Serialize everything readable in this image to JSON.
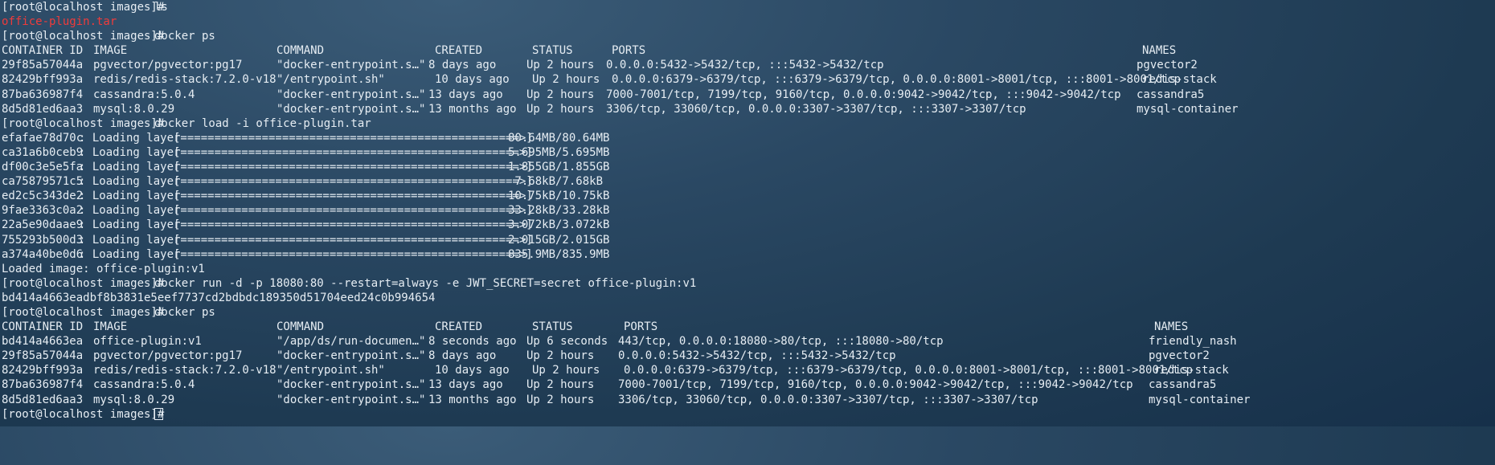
{
  "prompt": "[root@localhost images]# ",
  "ls_cmd": "ls",
  "ls_result": "office-plugin.tar",
  "ps_cmd": "docker ps",
  "headers": {
    "id": "CONTAINER ID",
    "image": "IMAGE",
    "command": "COMMAND",
    "created": "CREATED",
    "status": "STATUS",
    "ports": "PORTS",
    "names": "NAMES"
  },
  "ps1_rows": [
    {
      "id": "29f85a57044a",
      "image": "pgvector/pgvector:pg17",
      "command": "\"docker-entrypoint.s…\"",
      "created": "8 days ago",
      "status": "Up 2 hours",
      "ports": "0.0.0.0:5432->5432/tcp, :::5432->5432/tcp",
      "names": "pgvector2"
    },
    {
      "id": "82429bff993a",
      "image": "redis/redis-stack:7.2.0-v18",
      "command": "\"/entrypoint.sh\"",
      "created": "10 days ago",
      "status": "Up 2 hours",
      "ports": "0.0.0.0:6379->6379/tcp, :::6379->6379/tcp, 0.0.0.0:8001->8001/tcp, :::8001->8001/tcp",
      "names": "redis-stack"
    },
    {
      "id": "87ba636987f4",
      "image": "cassandra:5.0.4",
      "command": "\"docker-entrypoint.s…\"",
      "created": "13 days ago",
      "status": "Up 2 hours",
      "ports": "7000-7001/tcp, 7199/tcp, 9160/tcp, 0.0.0.0:9042->9042/tcp, :::9042->9042/tcp",
      "names": "cassandra5"
    },
    {
      "id": "8d5d81ed6aa3",
      "image": "mysql:8.0.29",
      "command": "\"docker-entrypoint.s…\"",
      "created": "13 months ago",
      "status": "Up 2 hours",
      "ports": "3306/tcp, 33060/tcp, 0.0.0.0:3307->3307/tcp, :::3307->3307/tcp",
      "names": "mysql-container"
    }
  ],
  "load_cmd": "docker load -i office-plugin.tar",
  "layers": [
    {
      "id": "efafae78d70c",
      "bar": "[==================================================>]",
      "size": "80.64MB/80.64MB"
    },
    {
      "id": "ca31a6b0ceb9",
      "bar": "[==================================================>]",
      "size": "5.695MB/5.695MB"
    },
    {
      "id": "df00c3e5e5fa",
      "bar": "[==================================================>]",
      "size": "1.855GB/1.855GB"
    },
    {
      "id": "ca75879571c5",
      "bar": "[==================================================>]",
      "size": " 7.68kB/7.68kB"
    },
    {
      "id": "ed2c5c343de2",
      "bar": "[==================================================>]",
      "size": "10.75kB/10.75kB"
    },
    {
      "id": "9fae3363c0a2",
      "bar": "[==================================================>]",
      "size": "33.28kB/33.28kB"
    },
    {
      "id": "22a5e90daae9",
      "bar": "[==================================================>]",
      "size": "3.072kB/3.072kB"
    },
    {
      "id": "755293b500d3",
      "bar": "[==================================================>]",
      "size": "2.015GB/2.015GB"
    },
    {
      "id": "a374a40be0d6",
      "bar": "[==================================================>]",
      "size": "835.9MB/835.9MB"
    }
  ],
  "layer_label": ": Loading layer ",
  "loaded": "Loaded image: office-plugin:v1",
  "run_cmd": "docker run -d -p 18080:80 --restart=always -e JWT_SECRET=secret office-plugin:v1",
  "run_hash": "bd414a4663eadbf8b3831e5eef7737cd2bdbdc189350d51704eed24c0b994654",
  "ps2_rows": [
    {
      "id": "bd414a4663ea",
      "image": "office-plugin:v1",
      "command": "\"/app/ds/run-documen…\"",
      "created": "8 seconds ago",
      "status": "Up 6 seconds",
      "ports": "443/tcp, 0.0.0.0:18080->80/tcp, :::18080->80/tcp",
      "names": "friendly_nash"
    },
    {
      "id": "29f85a57044a",
      "image": "pgvector/pgvector:pg17",
      "command": "\"docker-entrypoint.s…\"",
      "created": "8 days ago",
      "status": "Up 2 hours",
      "ports": "0.0.0.0:5432->5432/tcp, :::5432->5432/tcp",
      "names": "pgvector2"
    },
    {
      "id": "82429bff993a",
      "image": "redis/redis-stack:7.2.0-v18",
      "command": "\"/entrypoint.sh\"",
      "created": "10 days ago",
      "status": "Up 2 hours",
      "ports": "0.0.0.0:6379->6379/tcp, :::6379->6379/tcp, 0.0.0.0:8001->8001/tcp, :::8001->8001/tcp",
      "names": "redis-stack"
    },
    {
      "id": "87ba636987f4",
      "image": "cassandra:5.0.4",
      "command": "\"docker-entrypoint.s…\"",
      "created": "13 days ago",
      "status": "Up 2 hours",
      "ports": "7000-7001/tcp, 7199/tcp, 9160/tcp, 0.0.0.0:9042->9042/tcp, :::9042->9042/tcp",
      "names": "cassandra5"
    },
    {
      "id": "8d5d81ed6aa3",
      "image": "mysql:8.0.29",
      "command": "\"docker-entrypoint.s…\"",
      "created": "13 months ago",
      "status": "Up 2 hours",
      "ports": "3306/tcp, 33060/tcp, 0.0.0.0:3307->3307/tcp, :::3307->3307/tcp",
      "names": "mysql-container"
    }
  ],
  "colors": {
    "text": "#e6edf3",
    "filename": "#ef3b3b"
  }
}
